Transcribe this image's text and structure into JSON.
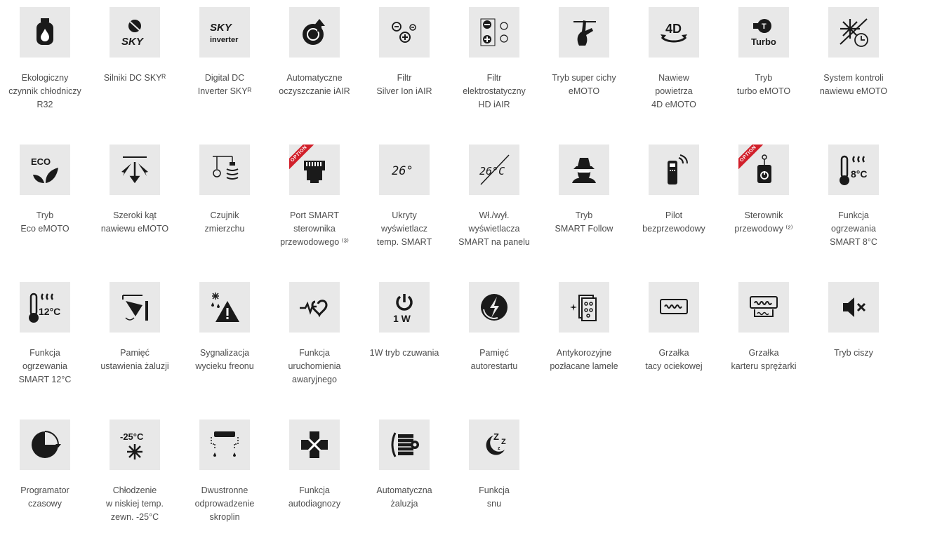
{
  "features": [
    {
      "label": "Ekologiczny\nczynnik chłodniczy\nR32",
      "icon": "gas-cylinder-icon"
    },
    {
      "label": "Silniki DC SKYᴿ",
      "icon": "sky-dc-motor-icon",
      "icon_text": "SKY"
    },
    {
      "label": "Digital DC\nInverter SKYᴿ",
      "icon": "sky-inverter-icon",
      "icon_text": "SKY",
      "icon_text_2": "inverter"
    },
    {
      "label": "Automatyczne\noczyszczanie iAIR",
      "icon": "auto-clean-icon"
    },
    {
      "label": "Filtr\nSilver Ion iAIR",
      "icon": "silver-ion-filter-icon"
    },
    {
      "label": "Filtr\nelektrostatyczny\nHD iAIR",
      "icon": "electrostatic-filter-icon"
    },
    {
      "label": "Tryb super cichy\neMOTO",
      "icon": "super-quiet-icon"
    },
    {
      "label": "Nawiew\npowietrza\n4D eMOTO",
      "icon": "airflow-4d-icon",
      "icon_text": "4D"
    },
    {
      "label": "Tryb\nturbo eMOTO",
      "icon": "turbo-icon",
      "icon_text": "Turbo"
    },
    {
      "label": "System kontroli\nnawiewu eMOTO",
      "icon": "airflow-control-icon"
    },
    {
      "label": "Tryb\nEco eMOTO",
      "icon": "eco-leaf-icon",
      "icon_text": "ECO"
    },
    {
      "label": "Szeroki kąt\nnawiewu eMOTO",
      "icon": "wide-angle-airflow-icon"
    },
    {
      "label": "Czujnik\nzmierzchu",
      "icon": "dusk-sensor-icon"
    },
    {
      "label": "Port SMART\nsterownika\nprzewodowego ⁽³⁾",
      "icon": "smart-port-icon",
      "ribbon": "OPTION"
    },
    {
      "label": "Ukryty\nwyświetlacz\ntemp. SMART",
      "icon": "hidden-display-icon",
      "icon_text": "26°"
    },
    {
      "label": "Wł./wył.\nwyświetlacza\nSMART na panelu",
      "icon": "display-toggle-icon",
      "icon_text": "26°C"
    },
    {
      "label": "Tryb\nSMART Follow",
      "icon": "smart-follow-icon"
    },
    {
      "label": "Pilot\nbezprzewodowy",
      "icon": "remote-control-icon"
    },
    {
      "label": "Sterownik\nprzewodowy ⁽²⁾",
      "icon": "wired-controller-icon",
      "ribbon": "OPTION"
    },
    {
      "label": "Funkcja\nogrzewania\nSMART 8°C",
      "icon": "heating-8c-icon",
      "icon_text": "8°C"
    },
    {
      "label": "Funkcja\nogrzewania\nSMART 12°C",
      "icon": "heating-12c-icon",
      "icon_text": "12°C"
    },
    {
      "label": "Pamięć\nustawienia żaluzji",
      "icon": "louver-memory-icon"
    },
    {
      "label": "Sygnalizacja\nwycieku freonu",
      "icon": "freon-leak-warning-icon"
    },
    {
      "label": "Funkcja\nuruchomienia\nawaryjnego",
      "icon": "emergency-start-icon"
    },
    {
      "label": "1W tryb czuwania",
      "icon": "standby-1w-icon",
      "icon_text": "1 W"
    },
    {
      "label": "Pamięć\nautorestartu",
      "icon": "auto-restart-icon"
    },
    {
      "label": "Antykorozyjne\npozłacane lamele",
      "icon": "golden-fins-icon"
    },
    {
      "label": "Grzałka\ntacy ociekowej",
      "icon": "drain-pan-heater-icon"
    },
    {
      "label": "Grzałka\nkarteru sprężarki",
      "icon": "crankcase-heater-icon"
    },
    {
      "label": "Tryb ciszy",
      "icon": "mute-icon"
    },
    {
      "label": "Programator\nczasowy",
      "icon": "timer-icon"
    },
    {
      "label": "Chłodzenie\nw niskiej temp.\nzewn. -25°C",
      "icon": "low-temp-cooling-icon",
      "icon_text": "-25°C"
    },
    {
      "label": "Dwustronne\nodprowadzenie\nskroplin",
      "icon": "dual-drain-icon"
    },
    {
      "label": "Funkcja\nautodiagnozy",
      "icon": "self-diagnosis-icon"
    },
    {
      "label": "Automatyczna\nżaluzja",
      "icon": "auto-louver-icon"
    },
    {
      "label": "Funkcja\nsnu",
      "icon": "sleep-icon",
      "icon_text": "Z"
    }
  ],
  "colors": {
    "tile_bg": "#e8e8e8",
    "icon": "#1a1a1a",
    "ribbon": "#d11f2a",
    "text": "#4d4d4d"
  }
}
